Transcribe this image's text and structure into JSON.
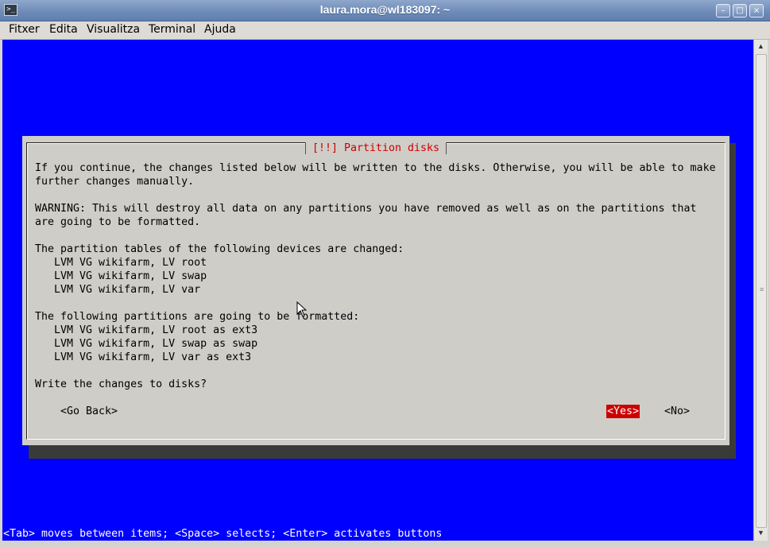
{
  "window": {
    "title": "laura.mora@wl183097: ~",
    "buttons": {
      "minimize": "–",
      "maximize": "□",
      "close": "×"
    }
  },
  "menu": {
    "items": [
      "Fitxer",
      "Edita",
      "Visualitza",
      "Terminal",
      "Ajuda"
    ]
  },
  "dialog": {
    "title": "[!!] Partition disks",
    "lines": [
      "If you continue, the changes listed below will be written to the disks. Otherwise, you will be able to make",
      "further changes manually.",
      "",
      "WARNING: This will destroy all data on any partitions you have removed as well as on the partitions that",
      "are going to be formatted.",
      "",
      "The partition tables of the following devices are changed:",
      "   LVM VG wikifarm, LV root",
      "   LVM VG wikifarm, LV swap",
      "   LVM VG wikifarm, LV var",
      "",
      "The following partitions are going to be formatted:",
      "   LVM VG wikifarm, LV root as ext3",
      "   LVM VG wikifarm, LV swap as swap",
      "   LVM VG wikifarm, LV var as ext3",
      "",
      "Write the changes to disks?"
    ],
    "buttons": {
      "go_back": "<Go Back>",
      "yes": "<Yes>",
      "no": "<No>"
    }
  },
  "status_line": "<Tab> moves between items; <Space> selects; <Enter> activates buttons",
  "colors": {
    "console_background": "#0000ff",
    "dialog_background": "#cfcdc8",
    "dialog_title": "#cc0000",
    "selected_button": "#cc0000"
  }
}
